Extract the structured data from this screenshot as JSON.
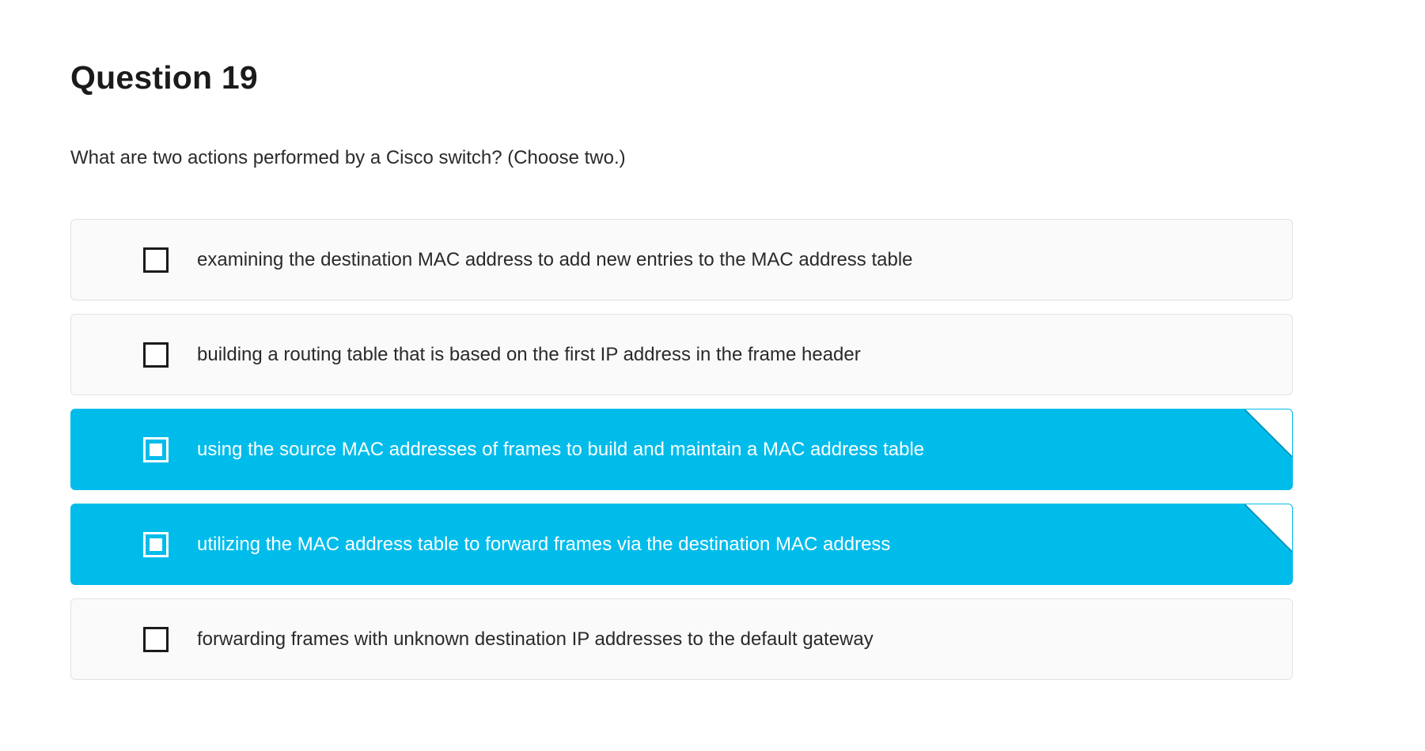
{
  "question": {
    "title": "Question 19",
    "prompt": "What are two actions performed by a Cisco switch? (Choose two.)"
  },
  "options": [
    {
      "label": "examining the destination MAC address to add new entries to the MAC address table",
      "selected": false
    },
    {
      "label": "building a routing table that is based on the first IP address in the frame header",
      "selected": false
    },
    {
      "label": "using the source MAC addresses of frames to build and maintain a MAC address table",
      "selected": true
    },
    {
      "label": "utilizing the MAC address table to forward frames via the destination MAC address",
      "selected": true
    },
    {
      "label": "forwarding frames with unknown destination IP addresses to the default gateway",
      "selected": false
    }
  ],
  "colors": {
    "selected_background": "#00bceb",
    "unselected_background": "#fafafa",
    "text": "#2a2a2a"
  },
  "icons": {
    "checkbox": "checkbox-icon",
    "corner": "corner-fold-icon"
  }
}
